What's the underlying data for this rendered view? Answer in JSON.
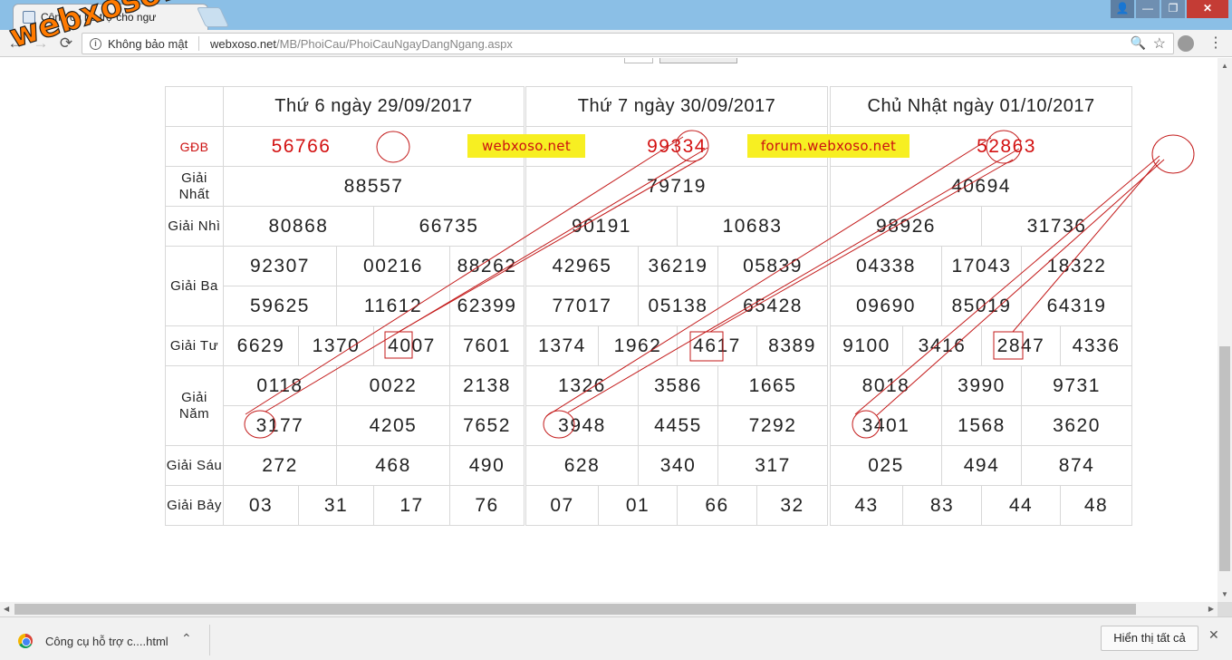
{
  "browser": {
    "tab_title": "Công cụ hỗ trợ cho ngư",
    "security_label": "Không bảo mật",
    "url_domain": "webxoso.net",
    "url_path": "/MB/PhoiCau/PhoiCauNgayDangNgang.aspx",
    "window_buttons": {
      "user": "👤",
      "minimize": "—",
      "maximize": "❐",
      "close": "✕"
    },
    "nav": {
      "back": "←",
      "forward": "→",
      "reload": "⟳"
    },
    "icons": {
      "info": "i",
      "zoom": "🔍",
      "star": "☆",
      "menu": "⋮"
    }
  },
  "watermark": "webxoso.net",
  "banners": {
    "left": "webxoso.net",
    "right": "forum.webxoso.net"
  },
  "labels": {
    "gdb": "GĐB",
    "giai_nhat": "Giải Nhất",
    "giai_nhi": "Giải Nhì",
    "giai_ba": "Giải Ba",
    "giai_tu": "Giải Tư",
    "giai_nam": "Giải Năm",
    "giai_sau": "Giải Sáu",
    "giai_bay": "Giải Bảy"
  },
  "days": [
    {
      "title": "Thứ 6 ngày 29/09/2017",
      "gdb": "56766",
      "nhat": "88557",
      "nhi": [
        "80868",
        "66735"
      ],
      "ba": [
        "92307",
        "00216",
        "88262",
        "59625",
        "11612",
        "62399"
      ],
      "tu": [
        "6629",
        "1370",
        "4007",
        "7601"
      ],
      "nam": [
        "0118",
        "0022",
        "2138",
        "3177",
        "4205",
        "7652"
      ],
      "sau": [
        "272",
        "468",
        "490"
      ],
      "bay": [
        "03",
        "31",
        "17",
        "76"
      ]
    },
    {
      "title": "Thứ 7 ngày 30/09/2017",
      "gdb": "99334",
      "nhat": "79719",
      "nhi": [
        "90191",
        "10683"
      ],
      "ba": [
        "42965",
        "36219",
        "05839",
        "77017",
        "05138",
        "65428"
      ],
      "tu": [
        "1374",
        "1962",
        "4617",
        "8389"
      ],
      "nam": [
        "1326",
        "3586",
        "1665",
        "3948",
        "4455",
        "7292"
      ],
      "sau": [
        "628",
        "340",
        "317"
      ],
      "bay": [
        "07",
        "01",
        "66",
        "32"
      ]
    },
    {
      "title": "Chủ Nhật ngày 01/10/2017",
      "gdb": "52863",
      "nhat": "40694",
      "nhi": [
        "98926",
        "31736"
      ],
      "ba": [
        "04338",
        "17043",
        "18322",
        "09690",
        "85019",
        "64319"
      ],
      "tu": [
        "9100",
        "3416",
        "2847",
        "4336"
      ],
      "nam": [
        "8018",
        "3990",
        "9731",
        "3401",
        "1568",
        "3620"
      ],
      "sau": [
        "025",
        "494",
        "874"
      ],
      "bay": [
        "43",
        "83",
        "44",
        "48"
      ]
    }
  ],
  "download": {
    "file_name": "Công cụ hỗ trợ c....html",
    "show_all": "Hiển thị tất cả",
    "chevron": "⌃",
    "close": "✕"
  }
}
